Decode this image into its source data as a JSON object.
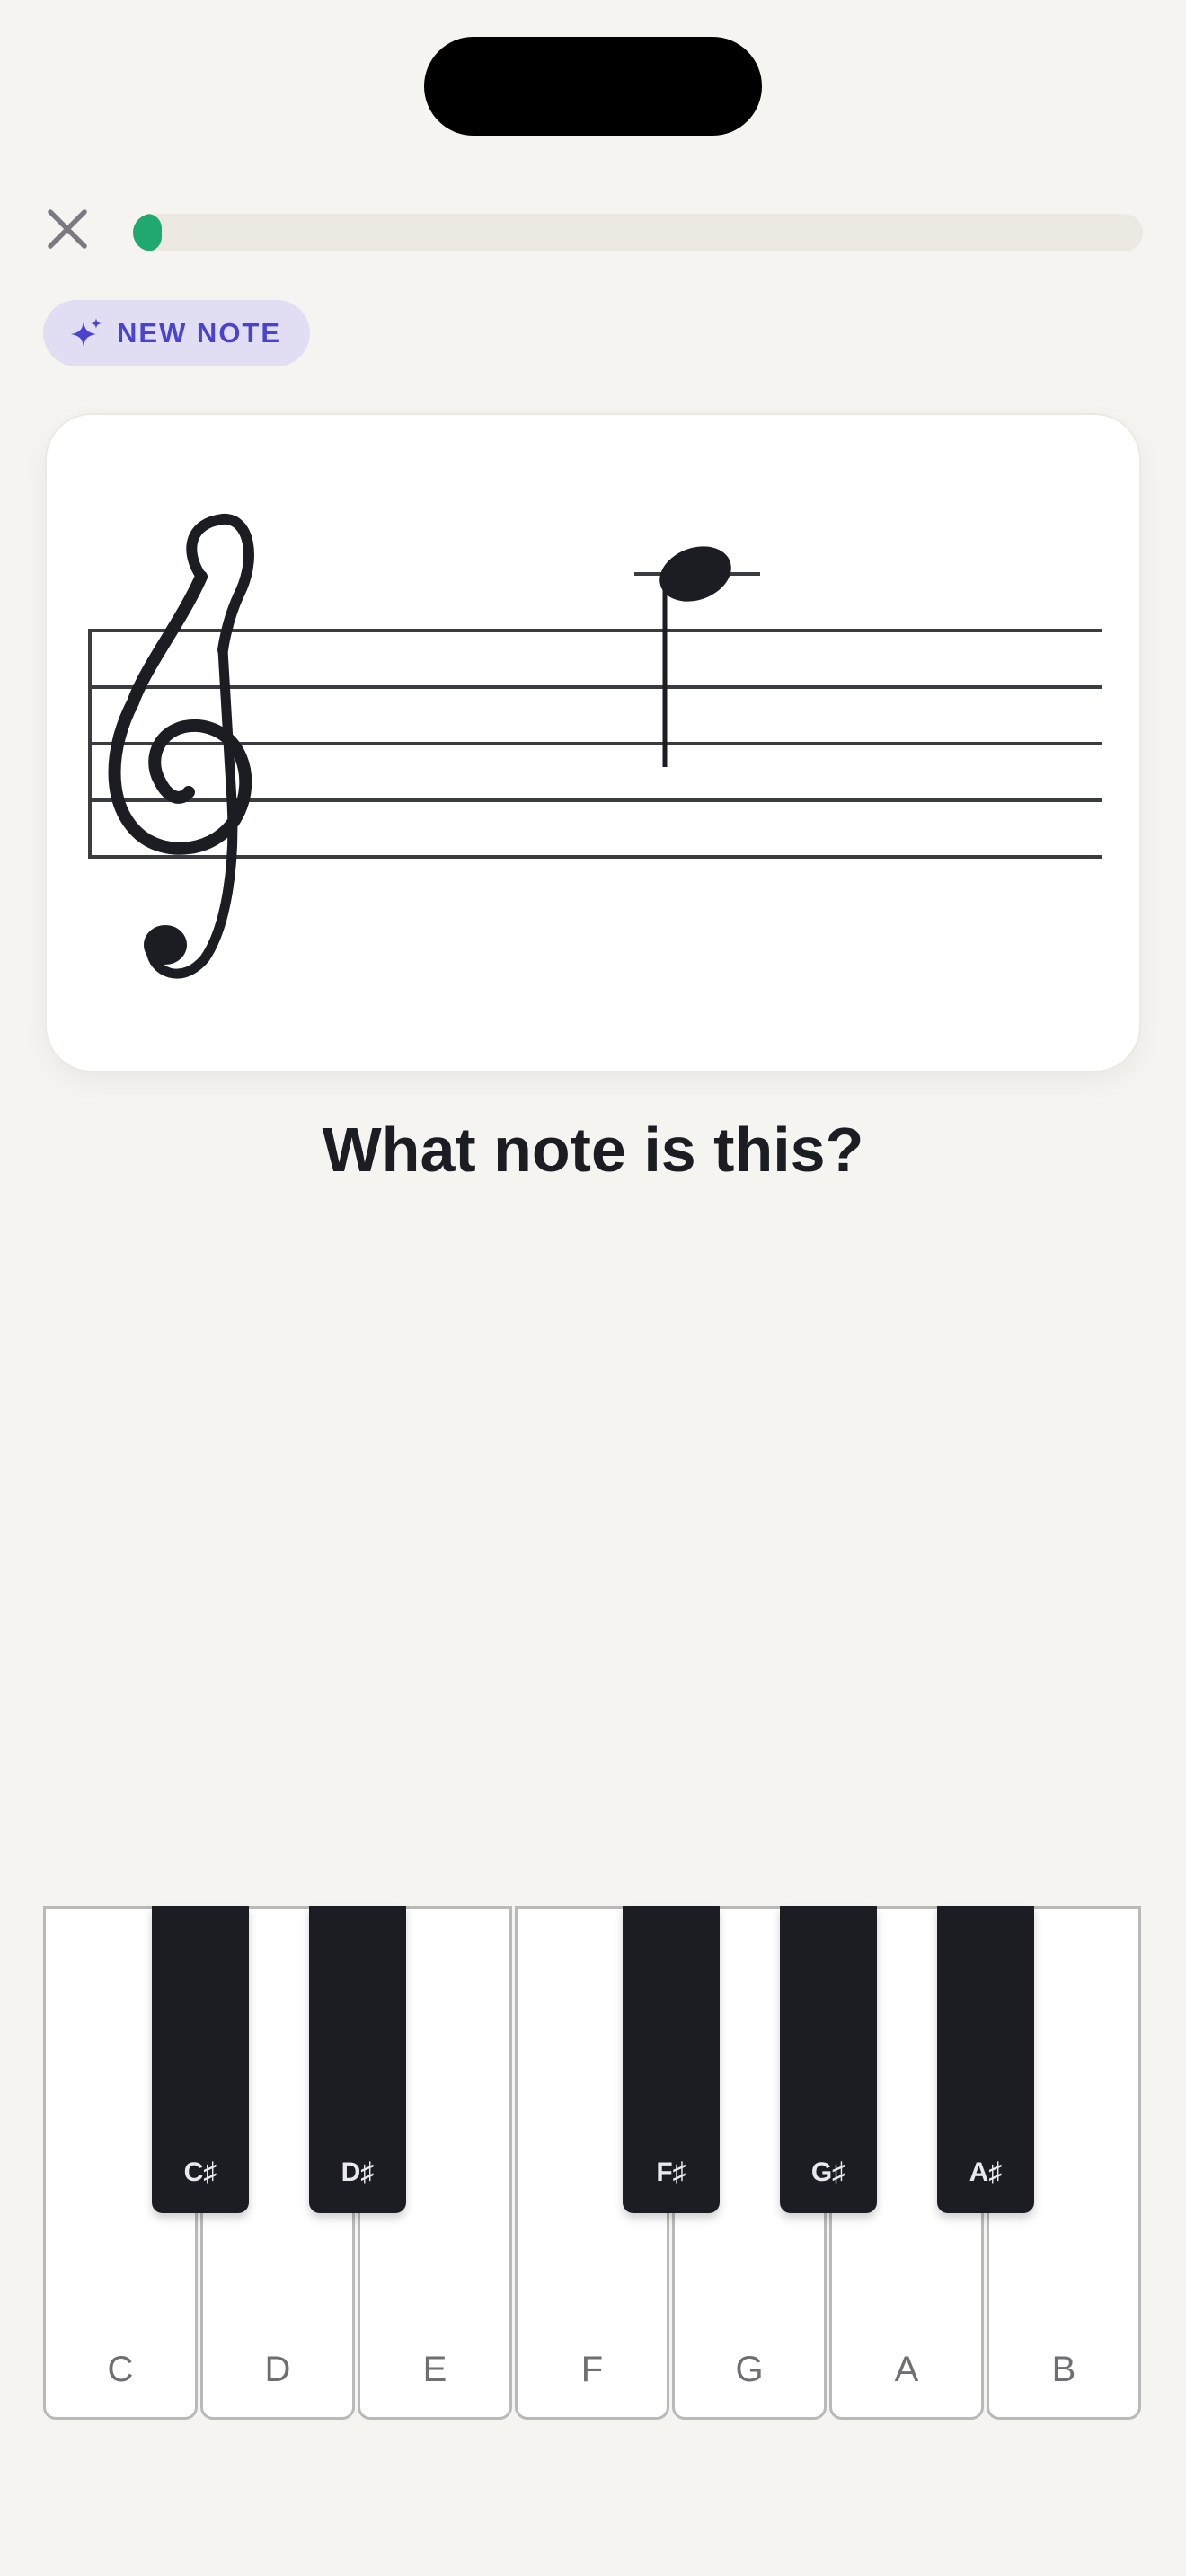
{
  "header": {
    "close_icon": "close-icon",
    "progress": 0.02,
    "progress_color": "#1fa970"
  },
  "badge": {
    "icon": "sparkle-icon",
    "label": "NEW NOTE",
    "color": "#4a43cf"
  },
  "staff": {
    "clef": "treble",
    "note": {
      "pitch": "A5",
      "duration": "quarter",
      "ledger_lines": 1,
      "stem": "down"
    }
  },
  "question": "What note is this?",
  "piano": {
    "white_keys": [
      "C",
      "D",
      "E",
      "F",
      "G",
      "A",
      "B"
    ],
    "black_keys": [
      "C♯",
      "D♯",
      "F♯",
      "G♯",
      "A♯"
    ]
  }
}
